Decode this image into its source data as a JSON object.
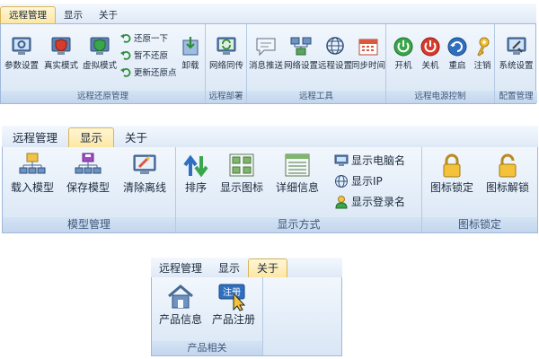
{
  "colors": {
    "ribbon_bg": "#dfe9f6",
    "active_tab": "#fde7a3",
    "border": "#9fb9d9",
    "group_label_bg": "#c9daef"
  },
  "ribbon1": {
    "tabs": [
      "远程管理",
      "显示",
      "关于"
    ],
    "active_tab": "远程管理",
    "groups": {
      "restore": {
        "label": "远程还原管理",
        "buttons": {
          "param": {
            "label": "参数设置",
            "icon": "monitor-gear-icon"
          },
          "real": {
            "label": "真实模式",
            "icon": "shield-red-icon"
          },
          "virtual": {
            "label": "虚拟模式",
            "icon": "shield-green-icon"
          },
          "restore_once": {
            "label": "还原一下",
            "icon": "undo-arrow-icon"
          },
          "pause": {
            "label": "暂不还原",
            "icon": "undo-arrow-icon"
          },
          "update_point": {
            "label": "更新还原点",
            "icon": "undo-arrow-icon"
          },
          "uninstall": {
            "label": "卸载",
            "icon": "uninstall-box-icon"
          }
        }
      },
      "deploy": {
        "label": "远程部署",
        "buttons": {
          "net_transfer": {
            "label": "网络同传",
            "icon": "sync-monitor-icon"
          }
        }
      },
      "tools": {
        "label": "远程工具",
        "buttons": {
          "message": {
            "label": "消息推送",
            "icon": "message-bubble-icon"
          },
          "network": {
            "label": "网络设置",
            "icon": "network-computers-icon"
          },
          "remote": {
            "label": "远程设置",
            "icon": "globe-icon"
          },
          "time": {
            "label": "同步时间",
            "icon": "calendar-icon"
          }
        }
      },
      "power": {
        "label": "远程电源控制",
        "buttons": {
          "on": {
            "label": "开机",
            "icon": "power-green-icon"
          },
          "off": {
            "label": "关机",
            "icon": "power-red-icon"
          },
          "restart": {
            "label": "重启",
            "icon": "restart-icon"
          },
          "logout": {
            "label": "注销",
            "icon": "key-icon"
          }
        }
      },
      "config": {
        "label": "配置管理",
        "buttons": {
          "sys": {
            "label": "系统设置",
            "icon": "settings-tools-icon"
          }
        }
      }
    }
  },
  "ribbon2": {
    "tabs": [
      "远程管理",
      "显示",
      "关于"
    ],
    "active_tab": "显示",
    "groups": {
      "model": {
        "label": "模型管理",
        "buttons": {
          "load": {
            "label": "载入模型",
            "icon": "load-model-icon"
          },
          "save": {
            "label": "保存模型",
            "icon": "save-model-icon"
          },
          "clear": {
            "label": "清除离线",
            "icon": "clear-offline-icon"
          }
        }
      },
      "display": {
        "label": "显示方式",
        "buttons": {
          "sort": {
            "label": "排序",
            "icon": "sort-arrows-icon"
          },
          "icon_view": {
            "label": "显示图标",
            "icon": "icon-grid-icon"
          },
          "detail": {
            "label": "详细信息",
            "icon": "detail-list-icon"
          },
          "pc_name": {
            "label": "显示电脑名",
            "icon": "computer-name-icon"
          },
          "ip": {
            "label": "显示IP",
            "icon": "globe-icon"
          },
          "login": {
            "label": "显示登录名",
            "icon": "user-icon"
          }
        }
      },
      "lock": {
        "label": "图标锁定",
        "buttons": {
          "lock": {
            "label": "图标锁定",
            "icon": "lock-icon"
          },
          "unlock": {
            "label": "图标解锁",
            "icon": "unlock-icon"
          }
        }
      }
    }
  },
  "ribbon3": {
    "tabs": [
      "远程管理",
      "显示",
      "关于"
    ],
    "active_tab": "关于",
    "groups": {
      "product": {
        "label": "产品相关",
        "buttons": {
          "info": {
            "label": "产品信息",
            "icon": "home-icon"
          },
          "register": {
            "label": "产品注册",
            "badge": "注册",
            "icon": "register-cursor-icon"
          }
        }
      }
    }
  }
}
